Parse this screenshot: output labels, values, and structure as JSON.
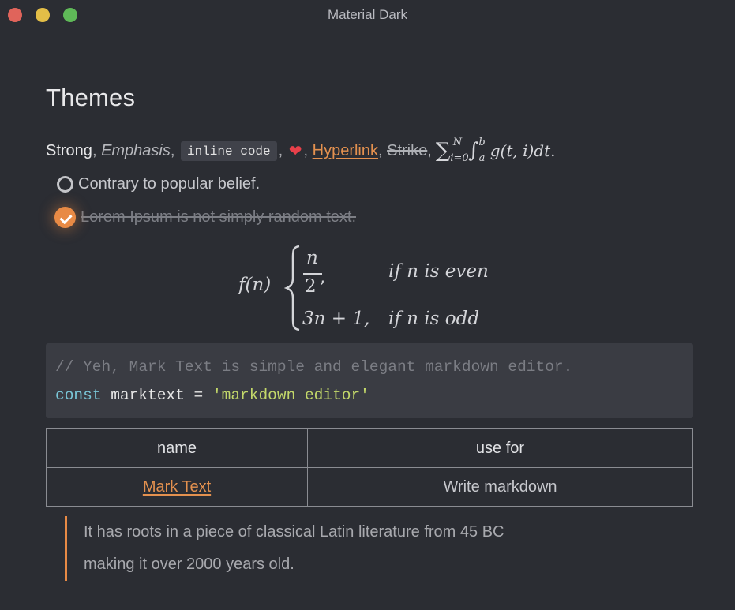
{
  "window": {
    "title": "Material Dark"
  },
  "heading": "Themes",
  "inline": {
    "strong": "Strong",
    "sep1": " ,",
    "emphasis": "Emphasis",
    "sep2": ",",
    "code": "inline code",
    "sep3": ",",
    "heart": "❤",
    "sep4": ",",
    "hyperlink": "Hyperlink",
    "sep5": ",",
    "strike": "Strike",
    "sep6": ",",
    "math": {
      "sum_lower": "i=0",
      "sum_upper": "N",
      "int_lower": "a",
      "int_upper": "b",
      "body": "g(t, i)dt",
      "end": " ."
    }
  },
  "tasks": [
    {
      "text": "Contrary to popular belief.",
      "checked": false
    },
    {
      "text": "Lorem Ipsum is not simply random text.",
      "checked": true
    }
  ],
  "math_block": {
    "fn": "f(n)",
    "case1_num": "n",
    "case1_den": "2",
    "case1_comma": ",",
    "case2": "3n + 1,",
    "cond1": "if n is even",
    "cond2": "if n is odd"
  },
  "code_block": {
    "comment": "// Yeh, Mark Text is simple and elegant markdown editor.",
    "keyword": "const",
    "name": " marktext = ",
    "string": "'markdown editor'"
  },
  "table": {
    "headers": [
      "name",
      "use for"
    ],
    "rows": [
      {
        "name": "Mark Text",
        "use_for": "Write markdown"
      }
    ]
  },
  "blockquote": {
    "line1": "It has roots in a piece of classical Latin literature from 45 BC",
    "line2": "making it over 2000 years old."
  },
  "colors": {
    "accent": "#e88a45",
    "background": "#2b2d33",
    "code_bg": "#3a3c43"
  }
}
